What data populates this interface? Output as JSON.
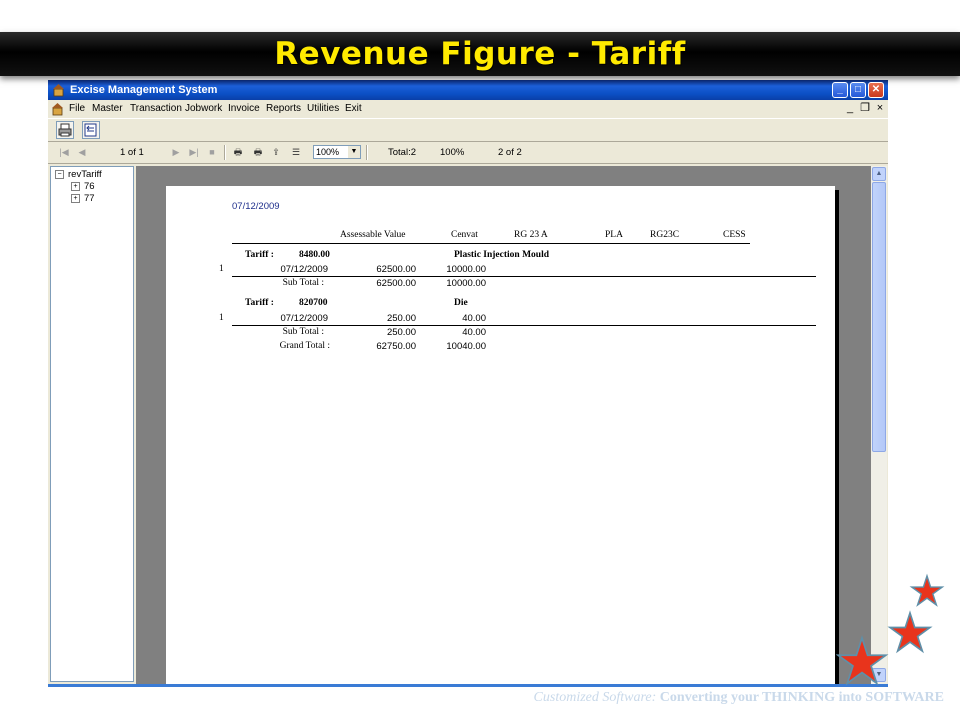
{
  "banner": {
    "title": "Revenue Figure - Tariff"
  },
  "window": {
    "title": "Excise Management System",
    "controls": {
      "minimize": "_",
      "maximize": "□",
      "close": "✕"
    }
  },
  "menu": {
    "items": [
      "File",
      "Master",
      "Transaction",
      "Jobwork",
      "Invoice",
      "Reports",
      "Utilities",
      "Exit"
    ],
    "mdi_controls": {
      "minimize": "_",
      "restore": "❐",
      "close": "×"
    }
  },
  "viewer_toolbar": {
    "page_indicator": "1 of 1",
    "zoom": "100%",
    "total": "Total:2",
    "percent": "100%",
    "record": "2 of 2"
  },
  "tree": {
    "root": "revTariff",
    "children": [
      "76",
      "77"
    ]
  },
  "report": {
    "date": "07/12/2009",
    "headers": {
      "assessable_value": "Assessable Value",
      "cenvat": "Cenvat",
      "rg23a": "RG 23 A",
      "pla": "PLA",
      "rg23c": "RG23C",
      "cess": "CESS"
    },
    "groups": [
      {
        "label": "Tariff :",
        "code": "8480.00",
        "description": "Plastic Injection Mould",
        "row_no": "1",
        "row_date": "07/12/2009",
        "row_value": "62500.00",
        "row_cenvat": "10000.00",
        "subtotal_label": "Sub  Total :",
        "subtotal_value": "62500.00",
        "subtotal_cenvat": "10000.00"
      },
      {
        "label": "Tariff :",
        "code": "820700",
        "description": "Die",
        "row_no": "1",
        "row_date": "07/12/2009",
        "row_value": "250.00",
        "row_cenvat": "40.00",
        "subtotal_label": "Sub  Total :",
        "subtotal_value": "250.00",
        "subtotal_cenvat": "40.00"
      }
    ],
    "grand_total": {
      "label": "Grand  Total :",
      "value": "62750.00",
      "cenvat": "10040.00"
    }
  },
  "footer": {
    "italic": "Customized Software:",
    "text": " Converting your THINKING into SOFTWARE"
  },
  "colors": {
    "banner_text": "#ffea00",
    "titlebar": "#0b4fc4",
    "star_fill": "#e8341c",
    "star_border": "#5f8fa8"
  }
}
